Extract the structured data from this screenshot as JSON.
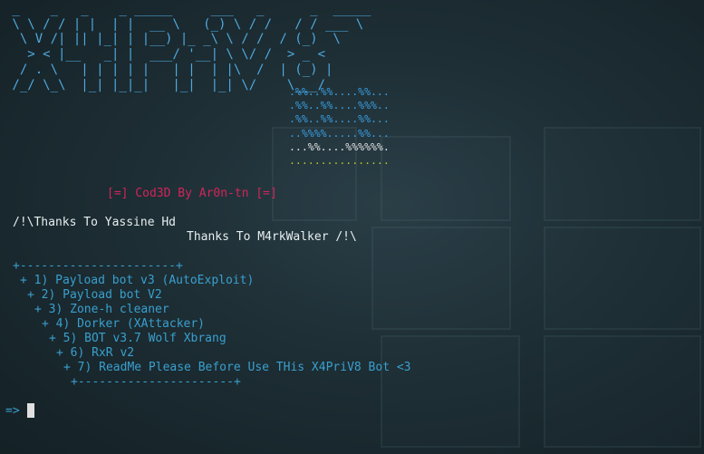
{
  "banner_ascii": [
    " _    _   _    _ _____     ___   _      _  _____ ",
    " \\ \\ / / | |  | |  __ \\   (_) \\ / /   / / ___ \\",
    "  \\ V /| || |_| | |__) |_ _\\ \\ / /  / (_)  \\",
    "   > < |__   _| |  ___/ '__| \\ \\/ /  > _ <",
    "  / . \\   | | | | |   | |  | |\\  /  | (_) |",
    " /_/ \\_\\  |_| |_|_|   |_|  |_| \\/    \\___/"
  ],
  "flag_art": [
    ".%%..%%....%%...",
    ".%%..%%....%%%..",
    ".%%..%%....%%...",
    "..%%%%.....%%...",
    "...%%....%%%%%%.",
    "................"
  ],
  "credits": {
    "coded_by": "[=] Cod3D By Ar0n-tn [=]",
    "thanks_1": "/!\\Thanks To Yassine Hd",
    "thanks_2": "Thanks To M4rkWalker /!\\"
  },
  "menu": {
    "border_top": "+----------------------+",
    "items": [
      "+ 1) Payload bot v3 (AutoExploit)",
      "+ 2) Payload bot V2",
      "+ 3) Zone-h cleaner",
      "+ 4) Dorker (XAttacker)",
      "+ 5) BOT v3.7 Wolf Xbrang",
      "+ 6) RxR v2",
      "+ 7) ReadMe Please Before Use THis X4PriV8 Bot <3"
    ],
    "border_bottom": "+----------------------+"
  },
  "prompt": "=>",
  "colors": {
    "banner": "#4fa9e0",
    "coded_by": "#d3245a",
    "menu": "#3a9fcf",
    "art_bottom": "#b8c22a"
  }
}
